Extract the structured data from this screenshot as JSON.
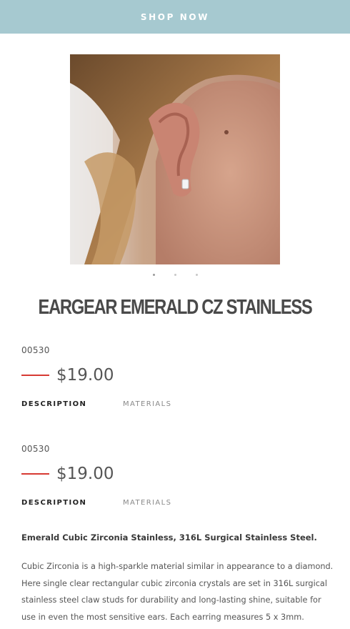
{
  "banner": {
    "label": "SHOP NOW"
  },
  "gallery": {
    "image_alt": "Ear wearing emerald cut CZ stud earring",
    "dots": [
      {
        "active": true
      },
      {
        "active": false
      },
      {
        "active": false
      }
    ]
  },
  "product": {
    "title": "EARGEAR EMERALD CZ STAINLESS"
  },
  "sections": [
    {
      "sku": "00530",
      "price": "$19.00",
      "tabs": {
        "description": "DESCRIPTION",
        "materials": "MATERIALS"
      }
    },
    {
      "sku": "00530",
      "price": "$19.00",
      "tabs": {
        "description": "DESCRIPTION",
        "materials": "MATERIALS"
      }
    }
  ],
  "description": {
    "heading": "Emerald Cubic Zirconia Stainless, 316L Surgical Stainless Steel.",
    "body": "Cubic Zirconia is a high-sparkle material similar in appearance to a diamond. Here single clear rectangular cubic zirconia crystals are set in 316L surgical stainless steel claw studs for durability and long-lasting shine, suitable for use in even the most sensitive ears. Each earring measures 5 x 3mm."
  },
  "colors": {
    "banner_bg": "#a6c9d0",
    "price_accent": "#d73a33"
  }
}
